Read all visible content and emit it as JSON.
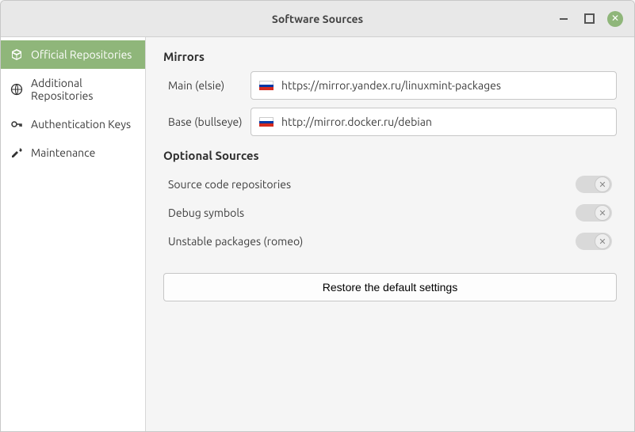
{
  "title": "Software Sources",
  "sidebar": {
    "items": [
      {
        "label": "Official Repositories",
        "icon": "cube-icon",
        "active": true
      },
      {
        "label": "Additional Repositories",
        "icon": "globe-icon",
        "active": false
      },
      {
        "label": "Authentication Keys",
        "icon": "key-icon",
        "active": false
      },
      {
        "label": "Maintenance",
        "icon": "tools-icon",
        "active": false
      }
    ]
  },
  "mirrors": {
    "heading": "Mirrors",
    "rows": [
      {
        "label": "Main (elsie)",
        "flag": "ru",
        "url": "https://mirror.yandex.ru/linuxmint-packages"
      },
      {
        "label": "Base (bullseye)",
        "flag": "ru",
        "url": "http://mirror.docker.ru/debian"
      }
    ]
  },
  "optional": {
    "heading": "Optional Sources",
    "rows": [
      {
        "label": "Source code repositories",
        "on": false
      },
      {
        "label": "Debug symbols",
        "on": false
      },
      {
        "label": "Unstable packages (romeo)",
        "on": false
      }
    ]
  },
  "restore_button": "Restore the default settings"
}
